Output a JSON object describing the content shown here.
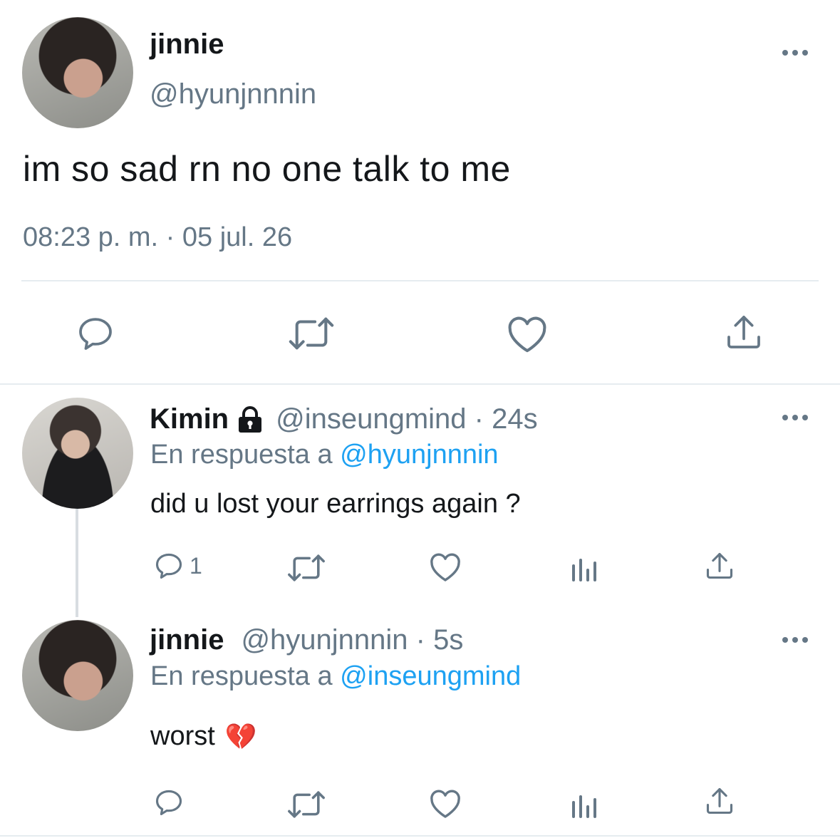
{
  "main_tweet": {
    "display_name": "jinnie",
    "handle": "@hyunjnnnin",
    "text": "im so sad rn no one talk to me",
    "timestamp": "08:23 p. m. · 05 jul. 26"
  },
  "replies": [
    {
      "display_name": "Kimin",
      "handle_time": "@inseungmind · 24s",
      "reply_prefix": "En respuesta a",
      "reply_to": "@hyunjnnnin",
      "text": "did u lost your earrings again ?",
      "reply_count": "1"
    },
    {
      "display_name": "jinnie",
      "handle_time": "@hyunjnnnin · 5s",
      "reply_prefix": "En respuesta a",
      "reply_to": "@inseungmind",
      "text": "worst",
      "emoji": "💔"
    }
  ],
  "colors": {
    "text": "#14171a",
    "secondary": "#657786",
    "link": "#1da1f2",
    "divider": "#e6ecf0"
  }
}
